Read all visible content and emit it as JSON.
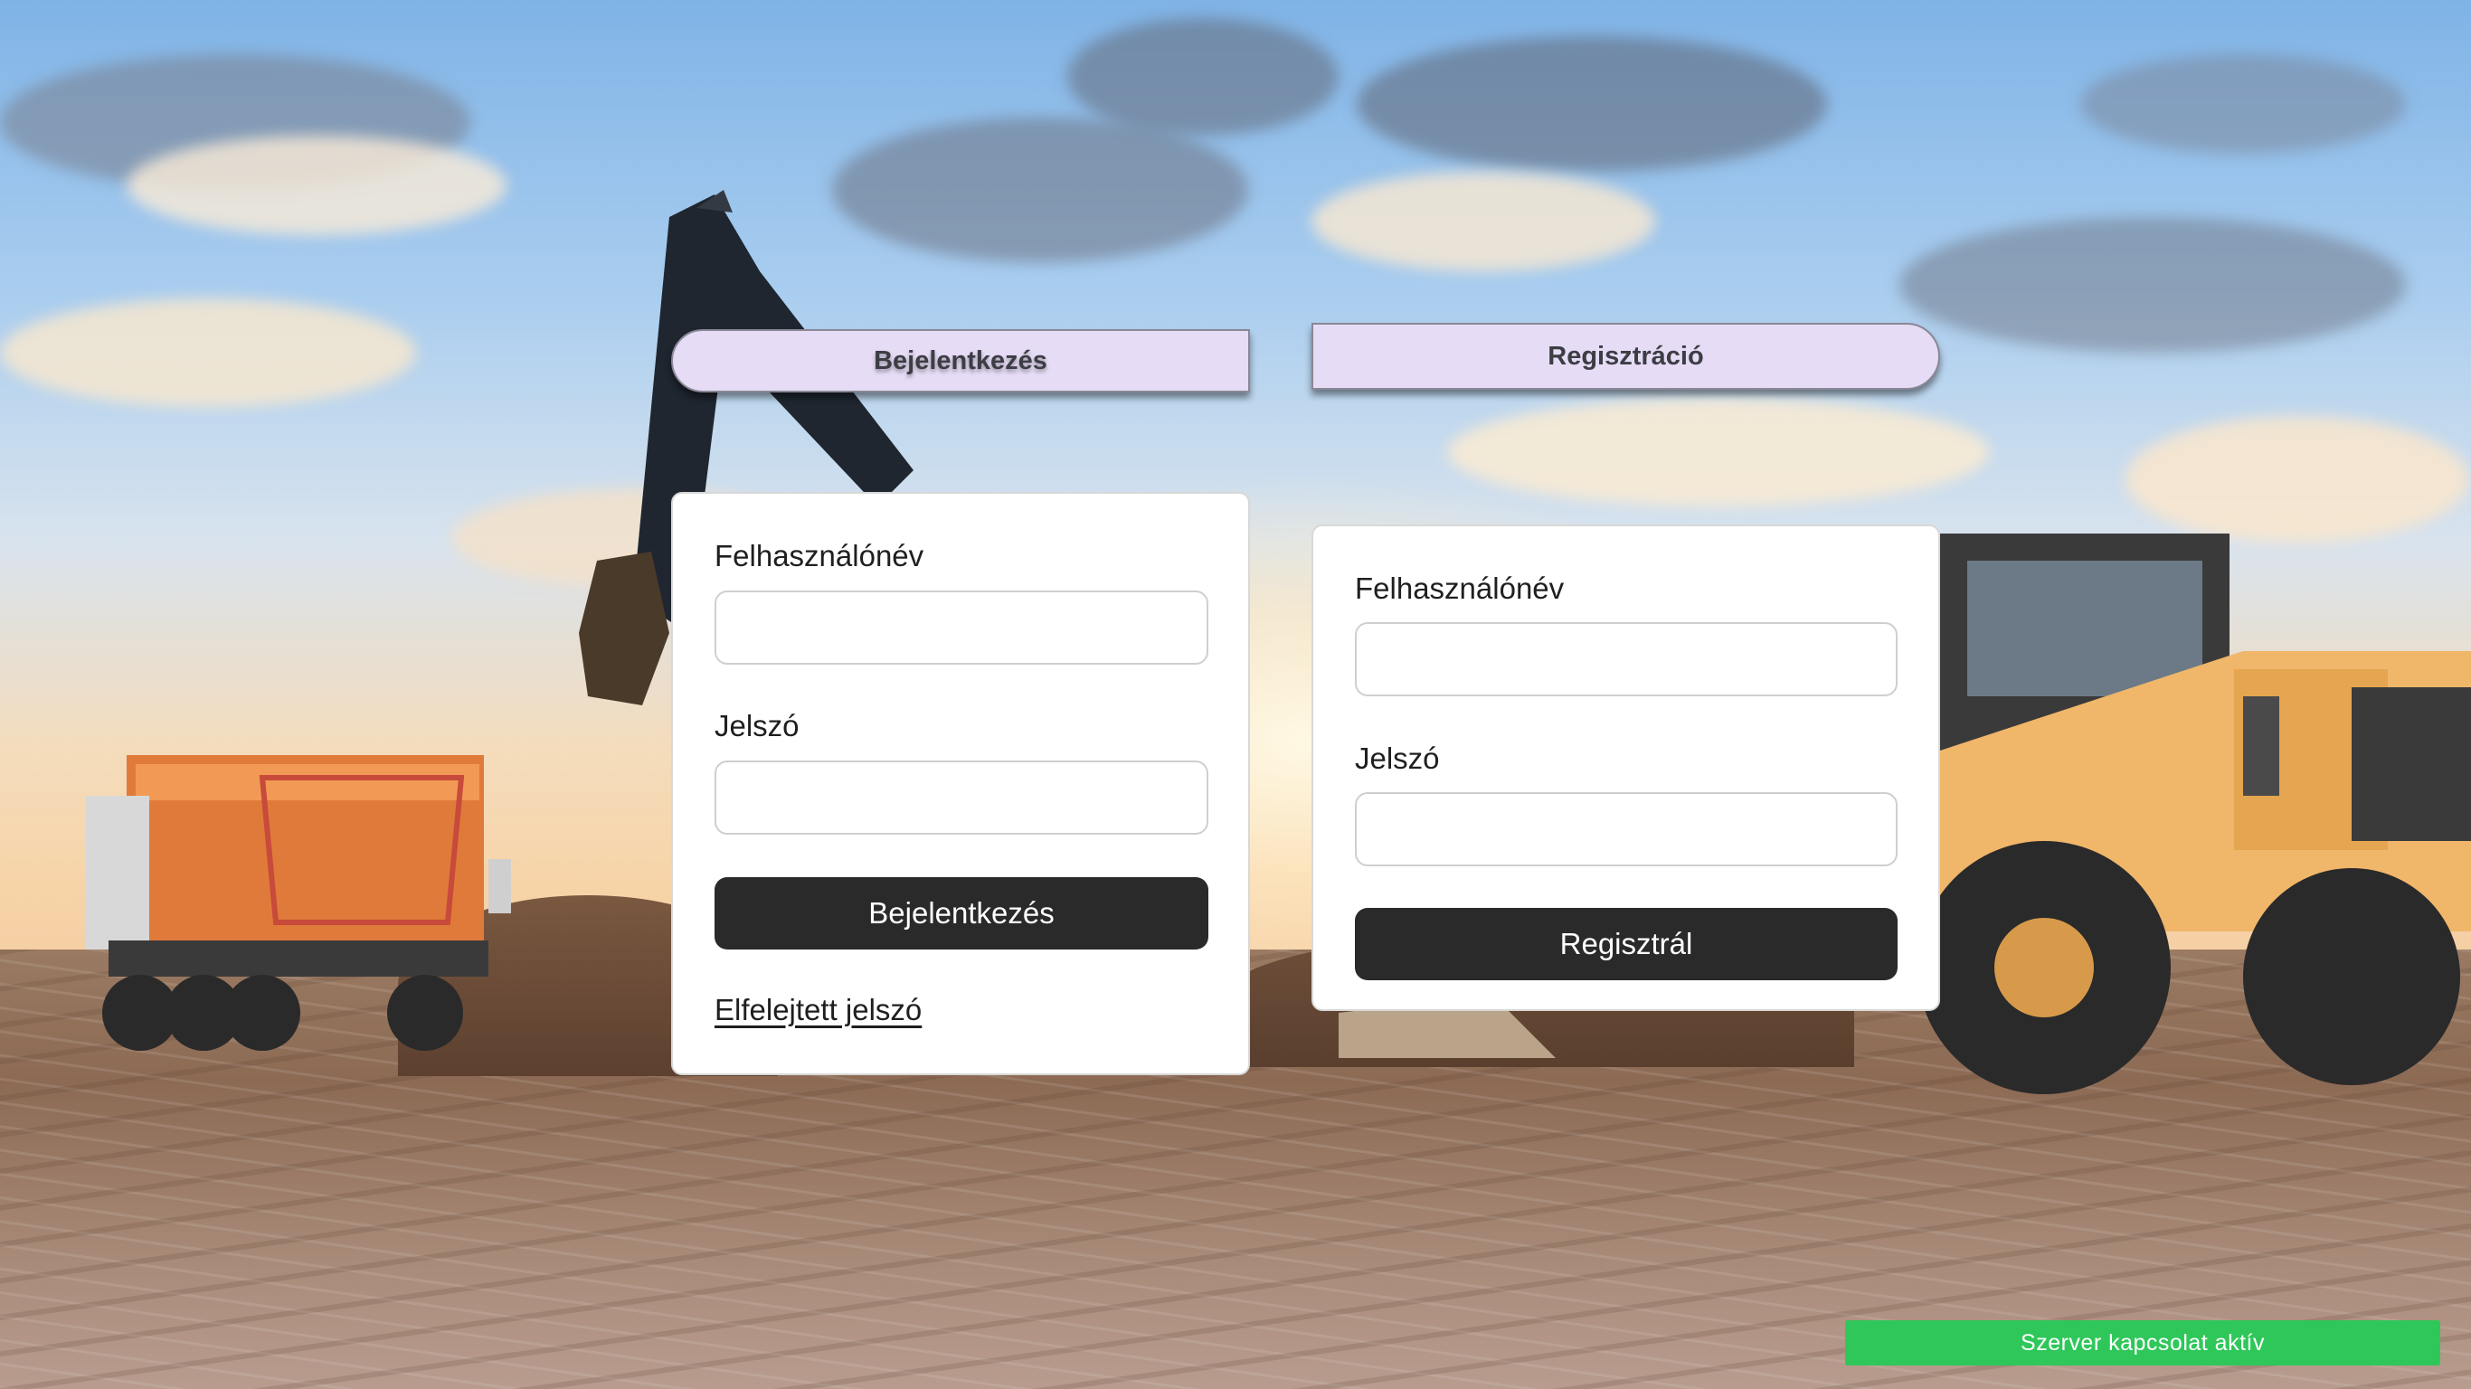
{
  "tabs": {
    "login_label": "Bejelentkezés",
    "register_label": "Regisztráció"
  },
  "login_form": {
    "username_label": "Felhasználónév",
    "username_value": "",
    "password_label": "Jelszó",
    "password_value": "",
    "submit_label": "Bejelentkezés",
    "forgot_password_label": "Elfelejtett jelszó"
  },
  "register_form": {
    "username_label": "Felhasználónév",
    "username_value": "",
    "password_label": "Jelszó",
    "password_value": "",
    "submit_label": "Regisztrál"
  },
  "status_bar": {
    "text": "Szerver kapcsolat aktív",
    "color": "#2fc75a"
  },
  "colors": {
    "tab_background": "#e6dcf6",
    "button_background": "#2a2a2a"
  }
}
